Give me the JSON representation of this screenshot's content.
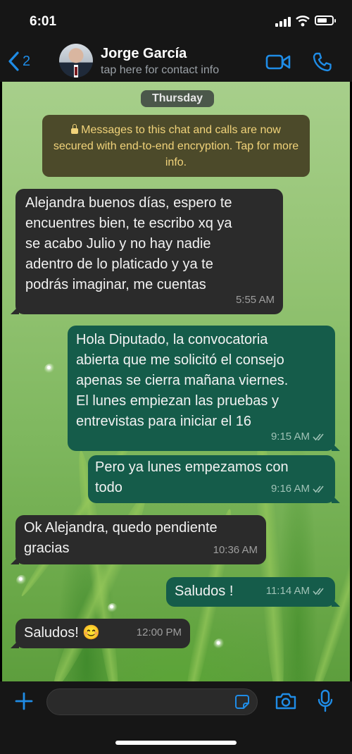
{
  "status": {
    "time": "6:01"
  },
  "header": {
    "back_count": "2",
    "contact_name": "Jorge García",
    "contact_subtitle": "tap here for contact info"
  },
  "chat": {
    "date_label": "Thursday",
    "encryption_notice": "Messages to this chat and calls are now secured with end-to-end encryption. Tap for more info.",
    "messages": [
      {
        "direction": "in",
        "text": "Alejandra buenos días, espero te\nencuentres bien, te escribo xq ya\nse acabo Julio y no hay nadie\nadentro de lo platicado y ya te\npodrás imaginar, me cuentas",
        "time": "5:55 AM"
      },
      {
        "direction": "out",
        "text": "Hola Diputado, la convocatoria\nabierta que me solicitó el consejo\napenas se cierra mañana viernes.\nEl lunes empiezan las pruebas y\nentrevistas para iniciar el 16",
        "time": "9:15 AM",
        "read": true
      },
      {
        "direction": "out",
        "text": "Pero ya lunes empezamos con\ntodo",
        "time": "9:16 AM",
        "read": true
      },
      {
        "direction": "in",
        "text": "Ok Alejandra, quedo pendiente\ngracias",
        "time": "10:36 AM"
      },
      {
        "direction": "out",
        "text": "Saludos !",
        "time": "11:14 AM",
        "read": true
      },
      {
        "direction": "in",
        "text": "Saludos! 😊",
        "time": "12:00 PM"
      }
    ]
  },
  "composer": {
    "placeholder": ""
  },
  "colors": {
    "accent": "#1f8ce6",
    "outgoing_bubble": "#155c4a",
    "incoming_bubble": "#2b2b2b",
    "notice_text": "#f1d37a"
  },
  "icons": [
    "back-chevron-icon",
    "video-call-icon",
    "phone-icon",
    "lock-icon",
    "plus-icon",
    "sticker-icon",
    "camera-icon",
    "microphone-icon",
    "double-check-icon"
  ]
}
